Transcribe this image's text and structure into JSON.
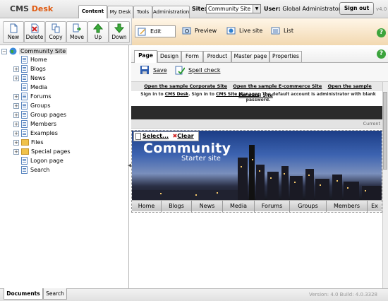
{
  "header": {
    "logo_cms": "CMS",
    "logo_desk": "Desk",
    "tabs": [
      "Content",
      "My Desk",
      "Tools",
      "Administration"
    ],
    "site_label": "Site:",
    "site_value": "Community Site",
    "user_label": "User:",
    "user_value": "Global Administrator",
    "signout_label": "Sign out",
    "version": "v4.0"
  },
  "toolbar": {
    "new": "New",
    "delete": "Delete",
    "copy": "Copy",
    "move": "Move",
    "up": "Up",
    "down": "Down"
  },
  "view_modes": {
    "edit": "Edit",
    "preview": "Preview",
    "live": "Live site",
    "list": "List"
  },
  "tree": {
    "root": "Community Site",
    "items": [
      "Home",
      "Blogs",
      "News",
      "Media",
      "Forums",
      "Groups",
      "Group pages",
      "Members",
      "Examples",
      "Files",
      "Special pages",
      "Logon page",
      "Search"
    ]
  },
  "content_tabs": [
    "Page",
    "Design",
    "Form",
    "Product",
    "Master page",
    "Properties"
  ],
  "actions": {
    "save": "Save",
    "spell": "Spell check"
  },
  "preview": {
    "link1": "Open the sample Corporate Site",
    "link2": "Open the sample E-commerce Site",
    "link3": "Open the sample Personal Site",
    "signin_a": "Sign in to",
    "signin_desk": "CMS Desk",
    "signin_b": ". Sign in to",
    "signin_mgr": "CMS Site Manager",
    "signin_c": ". The default account is administrator with blank password.",
    "current": "Current",
    "select": "Select...",
    "clear": "Clear",
    "banner_title": "Community",
    "banner_sub": "Starter site",
    "nav": [
      "Home",
      "Blogs",
      "News",
      "Media",
      "Forums",
      "Groups",
      "Members",
      "Ex"
    ]
  },
  "bottom": {
    "tabs": [
      "Documents",
      "Search"
    ],
    "build": "Version: 4.0 Build: 4.0.3328"
  }
}
